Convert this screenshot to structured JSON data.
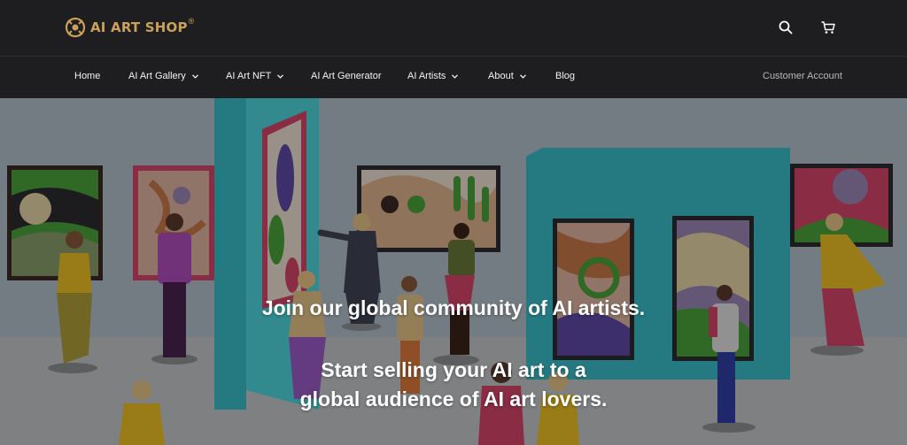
{
  "header": {
    "logo_text": "AI ART SHOP",
    "logo_registered": "®",
    "icons": [
      "search-icon",
      "cart-icon"
    ]
  },
  "nav": {
    "items": [
      {
        "label": "Home",
        "has_dropdown": false
      },
      {
        "label": "AI Art Gallery",
        "has_dropdown": true
      },
      {
        "label": "AI Art NFT",
        "has_dropdown": true
      },
      {
        "label": "AI Art Generator",
        "has_dropdown": false
      },
      {
        "label": "AI Artists",
        "has_dropdown": true
      },
      {
        "label": "About",
        "has_dropdown": true
      },
      {
        "label": "Blog",
        "has_dropdown": false
      }
    ],
    "account_label": "Customer Account"
  },
  "hero": {
    "headline": "Join our global community of AI artists.",
    "subline_1": "Start selling your AI art to a",
    "subline_2": "global audience of AI art lovers."
  },
  "colors": {
    "header_bg": "#1e1e20",
    "logo_gold": "#c9a15a",
    "nav_text": "#f2f2f2",
    "account_text": "#b8b8b8",
    "hero_overlay": "#000000"
  }
}
